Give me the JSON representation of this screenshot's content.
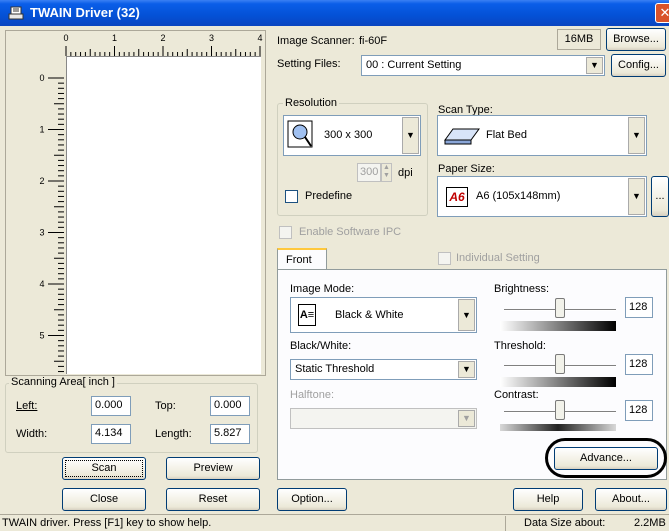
{
  "window": {
    "title": "TWAIN Driver (32)",
    "close_glyph": "✕"
  },
  "ruler": {
    "h_ticks": [
      "0",
      "1",
      "2",
      "3",
      "4"
    ],
    "v_ticks": [
      "0",
      "1",
      "2",
      "3",
      "4",
      "5"
    ]
  },
  "scanning_area": {
    "label": "Scanning Area[ inch ]",
    "left_label": "Left:",
    "left_value": "0.000",
    "top_label": "Top:",
    "top_value": "0.000",
    "width_label": "Width:",
    "width_value": "4.134",
    "length_label": "Length:",
    "length_value": "5.827"
  },
  "buttons": {
    "scan": "Scan",
    "preview": "Preview",
    "close": "Close",
    "reset": "Reset",
    "option": "Option...",
    "help": "Help",
    "about": "About...",
    "browse": "Browse...",
    "config": "Config...",
    "advance": "Advance...",
    "more": "..."
  },
  "scanner": {
    "label": "Image Scanner:",
    "model": "fi-60F",
    "memory": "16MB"
  },
  "setting_files": {
    "label": "Setting Files:",
    "value": "00 : Current Setting"
  },
  "resolution": {
    "label": "Resolution",
    "value": "300 x 300",
    "custom_value": "300",
    "unit": "dpi",
    "predefine_label": "Predefine"
  },
  "scan_type": {
    "label": "Scan Type:",
    "value": "Flat Bed"
  },
  "paper_size": {
    "label": "Paper Size:",
    "value": "A6 (105x148mm)",
    "badge": "A6"
  },
  "software_ipc": {
    "label": "Enable Software IPC"
  },
  "tabs": {
    "front": "Front",
    "individual_setting": "Individual Setting"
  },
  "image_mode": {
    "label": "Image Mode:",
    "value": "Black & White",
    "icon_glyph": "A≡"
  },
  "black_white": {
    "label": "Black/White:",
    "value": "Static Threshold"
  },
  "halftone": {
    "label": "Halftone:",
    "value": ""
  },
  "brightness": {
    "label": "Brightness:",
    "value": "128",
    "level": 0.5
  },
  "threshold": {
    "label": "Threshold:",
    "value": "128",
    "level": 0.5
  },
  "contrast": {
    "label": "Contrast:",
    "value": "128",
    "level": 0.5
  },
  "statusbar": {
    "help_text": "TWAIN driver. Press [F1] key to show help.",
    "data_size_label": "Data Size about:",
    "data_size_value": "2.2MB"
  },
  "colors": {
    "title_bar": "#0451d6",
    "highlight_ring": "#000000",
    "face": "#ece9d8"
  }
}
